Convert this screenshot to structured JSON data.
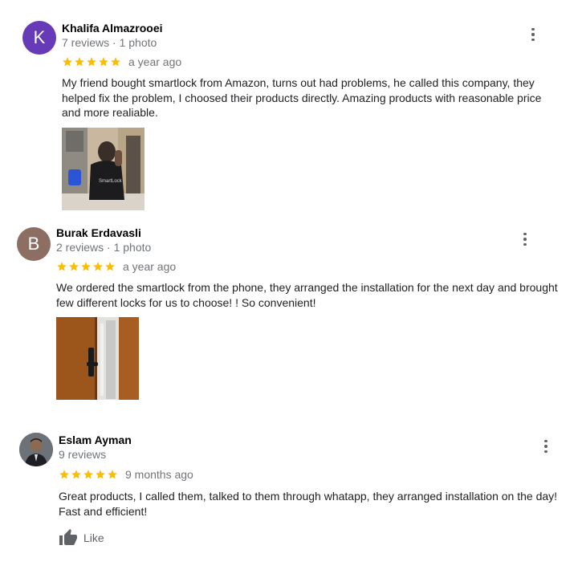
{
  "colors": {
    "star": "#fbbc04",
    "avatar_k": "#673ab7",
    "avatar_b": "#8d6e63",
    "meta_text": "#70757a"
  },
  "reviews": [
    {
      "avatar_letter": "K",
      "name": "Khalifa Almazrooei",
      "meta": "7 reviews · 1 photo",
      "rating": 5,
      "ago": "a year ago",
      "text": "My friend bought smartlock from Amazon, turns out had problems, he called this company, they helped fix the problem, I choosed their products directly. Amazing products with reasonable price and more realiable.",
      "photo_icon": "installer-photo"
    },
    {
      "avatar_letter": "B",
      "name": "Burak Erdavasli",
      "meta": "2 reviews · 1 photo",
      "rating": 5,
      "ago": "a year ago",
      "text": "We ordered the smartlock from the phone, they arranged the installation for the next day and brought few different locks for us to choose! ! So convenient!",
      "photo_icon": "door-lock-photo"
    },
    {
      "avatar_letter": "",
      "name": "Eslam Ayman",
      "meta": "9 reviews",
      "rating": 5,
      "ago": "9 months ago",
      "text": "Great products, I called them, talked to them through whatapp, they arranged installation on the day! Fast and efficient!",
      "like_label": "Like"
    }
  ]
}
